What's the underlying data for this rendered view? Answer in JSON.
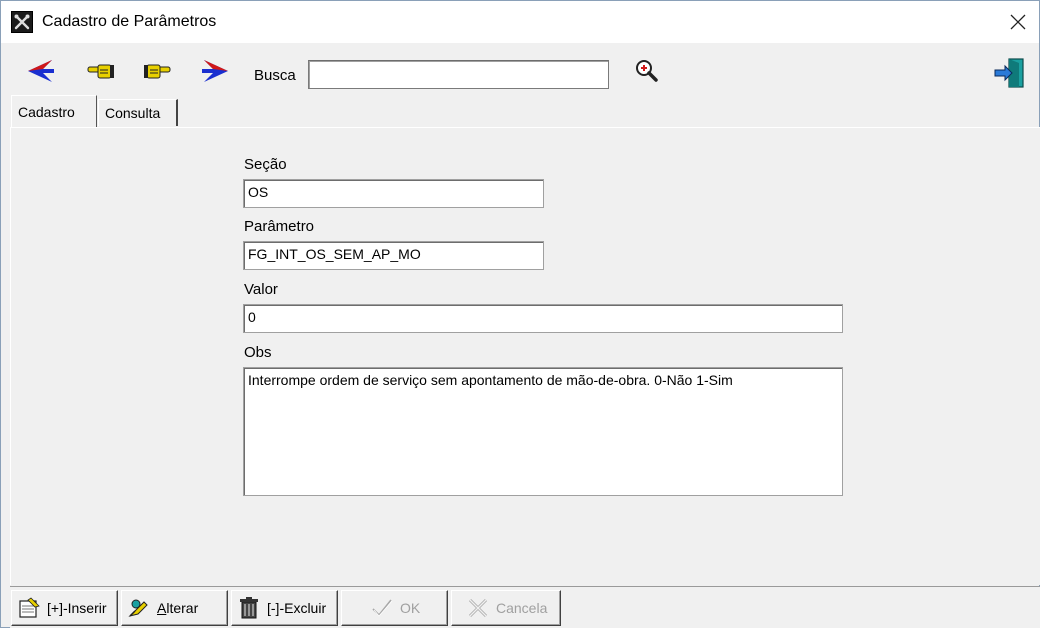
{
  "window": {
    "title": "Cadastro de Parâmetros"
  },
  "toolbar": {
    "buttons": [
      {
        "name": "first-record",
        "icon": "arrow-left-icon"
      },
      {
        "name": "previous-record",
        "icon": "hand-pointing-left-icon"
      },
      {
        "name": "next-record",
        "icon": "hand-pointing-right-icon"
      },
      {
        "name": "last-record",
        "icon": "arrow-right-icon"
      }
    ],
    "search_label": "Busca",
    "search_value": "",
    "search_icon": "magnifier-zoom-icon",
    "exit_icon": "exit-door-icon"
  },
  "tabs": [
    {
      "label": "Cadastro",
      "active": true
    },
    {
      "label": "Consulta",
      "active": false
    }
  ],
  "form": {
    "secao": {
      "label": "Seção",
      "value": "OS"
    },
    "parametro": {
      "label": "Parâmetro",
      "value": "FG_INT_OS_SEM_AP_MO"
    },
    "valor": {
      "label": "Valor",
      "value": "0"
    },
    "obs": {
      "label": "Obs",
      "value": "Interrompe ordem de serviço sem apontamento de mão-de-obra. 0-Não 1-Sim"
    }
  },
  "actions": {
    "inserir": {
      "label_prefix": "[+]-",
      "label": "Inserir",
      "enabled": true,
      "icon": "insert-record-icon"
    },
    "alterar": {
      "label_u": "A",
      "label_rest": "lterar",
      "enabled": true,
      "icon": "edit-record-icon"
    },
    "excluir": {
      "label": "[-]-Excluir",
      "enabled": true,
      "icon": "trash-icon"
    },
    "ok": {
      "label": "OK",
      "enabled": false,
      "icon": "check-icon"
    },
    "cancela": {
      "label": "Cancela",
      "enabled": false,
      "icon": "x-icon"
    }
  },
  "colors": {
    "arrow_blue": "#1a2fd0",
    "arrow_red": "#d01818",
    "hand_yellow": "#e8d000",
    "exit_teal": "#1aa0a0"
  }
}
